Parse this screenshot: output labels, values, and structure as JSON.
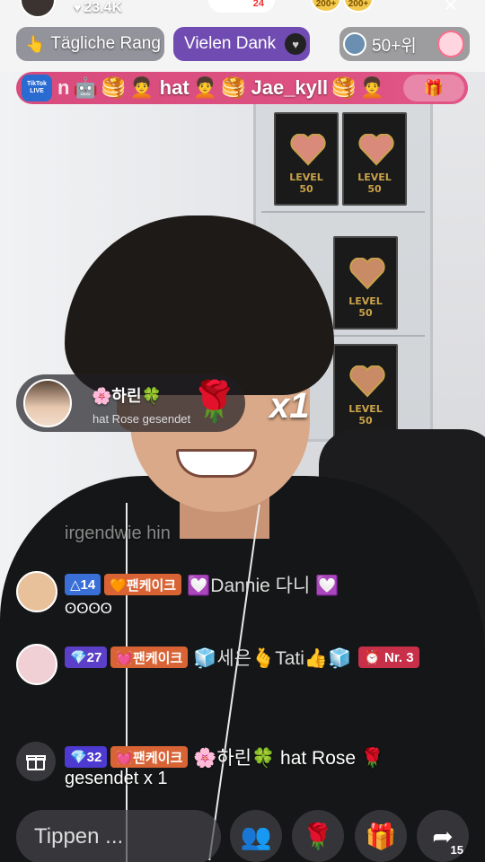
{
  "header": {
    "likes": "23.4K",
    "like_icon": "heart-icon",
    "follow_count": "24",
    "coin_badges": [
      "200+",
      "200+"
    ],
    "close_icon": "close-icon"
  },
  "pills": {
    "ranking_label": "Tägliche Rang",
    "thanks_label": "Vielen Dank",
    "viewer_rank": "50+위"
  },
  "banner": {
    "source_badge": "TikTok LIVE",
    "lead_text": "n",
    "verb": "hat",
    "name": "Jae_kyll",
    "emojis_left": [
      "🤖",
      "🥞",
      "🧑‍🦱"
    ],
    "emojis_mid": [
      "🧑‍🦱",
      "🥞"
    ],
    "emojis_right": [
      "🥞",
      "🧑‍🦱"
    ],
    "gift_icon": "🎁"
  },
  "gift_combo": {
    "sender": "🌸하린🍀",
    "description": "hat Rose  gesendet",
    "gift_emoji": "🌹",
    "count": "x1"
  },
  "comments": {
    "faded": "irgendwie  hin",
    "items": [
      {
        "level": "△14",
        "level_color": "#3a6fd8",
        "fan_badge": "🧡팬케이크",
        "name": "💟Dannie 다니 💟",
        "sub": "ʘʘʘʘ",
        "avatar_color": "#e8c09a"
      },
      {
        "level": "💎27",
        "level_color": "#5b3fc8",
        "fan_badge": "💓팬케이크",
        "name": "🧊세은🫰Tati👍🧊",
        "nr": "⏰ Nr. 3",
        "avatar_color": "#f0d0d4"
      },
      {
        "level": "💎32",
        "level_color": "#4d3ad0",
        "fan_badge": "💓팬케이크",
        "name": "🌸하린🍀 hat Rose 🌹",
        "sub": "gesendet x 1"
      }
    ]
  },
  "bottom_bar": {
    "input_placeholder": "Tippen ...",
    "buttons": [
      "👥",
      "🌹",
      "🎁",
      "➦"
    ],
    "share_count": "15"
  },
  "colors": {
    "banner": "#d84b7c",
    "thanks_pill": "#643caa",
    "fan_badge": "#d86436"
  }
}
